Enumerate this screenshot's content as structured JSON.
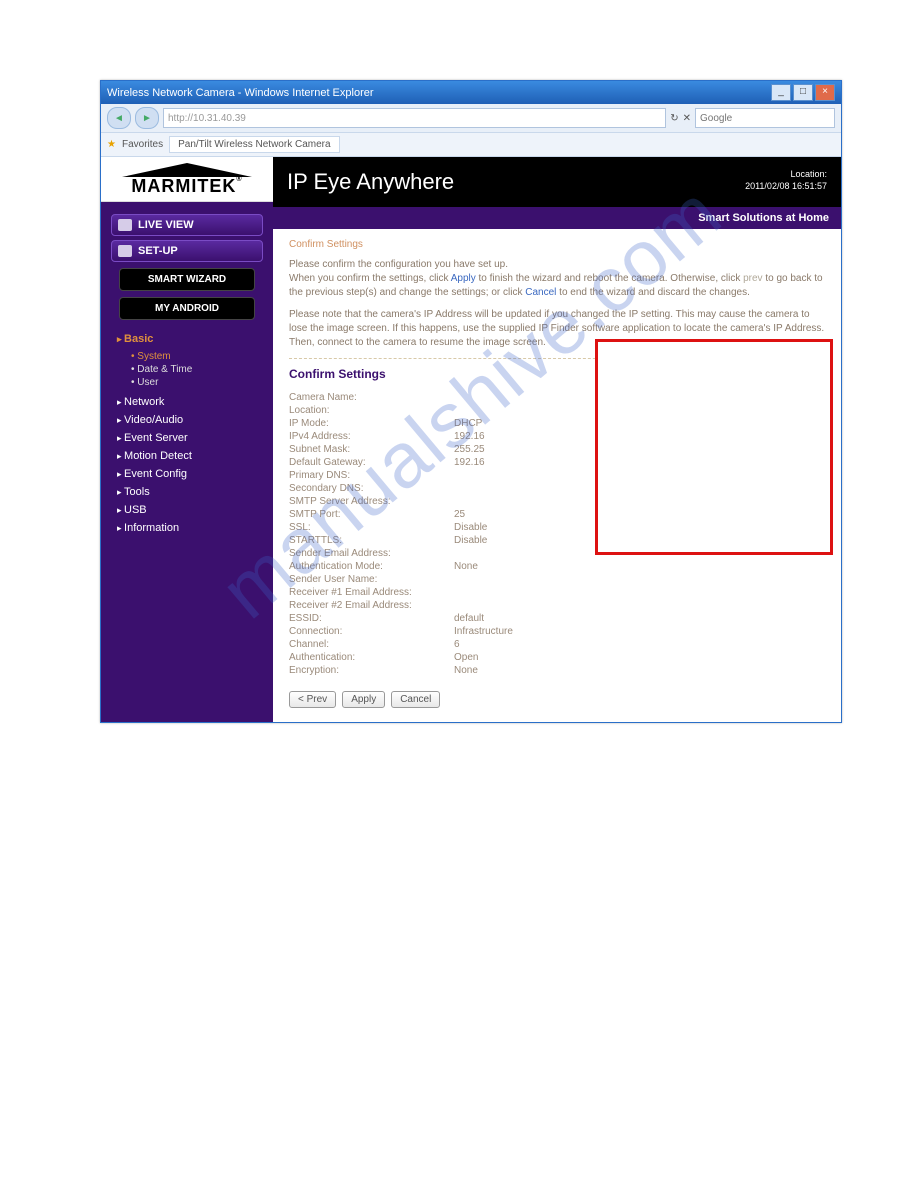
{
  "window": {
    "title": "Wireless Network Camera - Windows Internet Explorer",
    "address": "http://10.31.40.39",
    "favorites_label": "Favorites",
    "tab_label": "Pan/Tilt Wireless Network Camera"
  },
  "logo": "MARMITEK",
  "side_buttons": {
    "live_view": "LIVE VIEW",
    "setup": "SET-UP",
    "smart_wizard": "SMART WIZARD",
    "my_android": "MY ANDROID"
  },
  "menu": {
    "basic": {
      "label": "Basic",
      "items": [
        "System",
        "Date & Time",
        "User"
      ],
      "active_index": 0
    },
    "items": [
      "Network",
      "Video/Audio",
      "Event Server",
      "Motion Detect",
      "Event Config",
      "Tools",
      "USB",
      "Information"
    ]
  },
  "header": {
    "title": "IP Eye Anywhere",
    "location_label": "Location:",
    "timestamp": "2011/02/08 16:51:57",
    "tagline": "Smart Solutions at Home"
  },
  "panel": {
    "crumb": "Confirm Settings",
    "p1_a": "Please confirm the configuration you have set up.",
    "p1_b": "When you confirm the settings, click ",
    "p1_apply": "Apply",
    "p1_c": " to finish the wizard and reboot the camera. Otherwise, click ",
    "p1_prev": "prev",
    "p1_d": " to go back to the previous step(s) and change the settings; or click ",
    "p1_cancel": "Cancel",
    "p1_e": " to end the wizard and discard the changes.",
    "p2": "Please note that the camera's IP Address will be updated if you changed the IP setting. This may cause the camera to lose the image screen. If this happens, use the supplied IP Finder software application to locate the camera's IP Address. Then, connect to the camera to resume the image screen.",
    "section_title": "Confirm Settings",
    "rows": [
      {
        "k": "Camera Name:",
        "v": ""
      },
      {
        "k": "Location:",
        "v": ""
      },
      {
        "k": "IP Mode:",
        "v": "DHCP"
      },
      {
        "k": "IPv4 Address:",
        "v": "192.16"
      },
      {
        "k": "Subnet Mask:",
        "v": "255.25"
      },
      {
        "k": "Default Gateway:",
        "v": "192.16"
      },
      {
        "k": "Primary DNS:",
        "v": ""
      },
      {
        "k": "Secondary DNS:",
        "v": ""
      },
      {
        "k": "SMTP Server Address:",
        "v": ""
      },
      {
        "k": "SMTP Port:",
        "v": "25"
      },
      {
        "k": "SSL:",
        "v": "Disable"
      },
      {
        "k": "STARTTLS:",
        "v": "Disable"
      },
      {
        "k": "Sender Email Address:",
        "v": ""
      },
      {
        "k": "Authentication Mode:",
        "v": "None"
      },
      {
        "k": "Sender User Name:",
        "v": ""
      },
      {
        "k": "Receiver #1 Email Address:",
        "v": ""
      },
      {
        "k": "Receiver #2 Email Address:",
        "v": ""
      },
      {
        "k": "ESSID:",
        "v": "default"
      },
      {
        "k": "Connection:",
        "v": "Infrastructure"
      },
      {
        "k": "Channel:",
        "v": "6"
      },
      {
        "k": "Authentication:",
        "v": "Open"
      },
      {
        "k": "Encryption:",
        "v": "None"
      }
    ],
    "buttons": {
      "prev": "< Prev",
      "apply": "Apply",
      "cancel": "Cancel"
    }
  },
  "watermark": "manualshive.com"
}
